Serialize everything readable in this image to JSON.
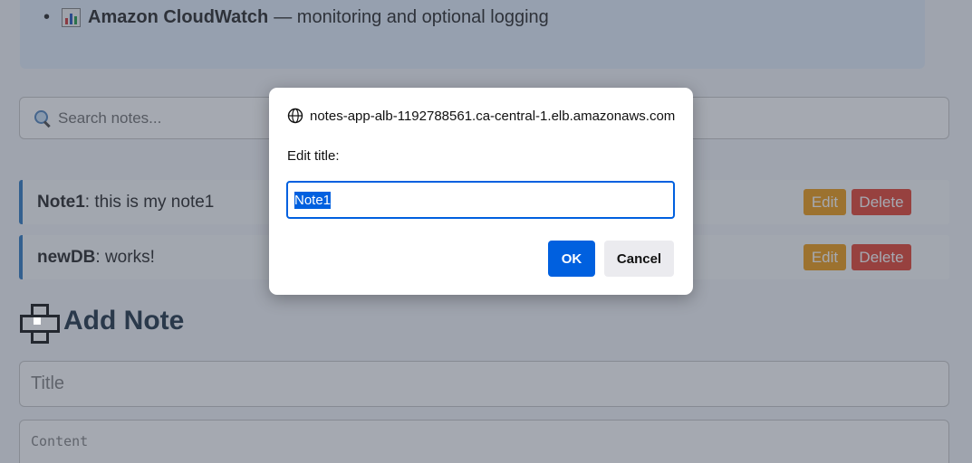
{
  "info": {
    "cloudwatch_name": "Amazon CloudWatch",
    "cloudwatch_desc": "— monitoring and optional logging",
    "icon": "bar-chart-icon"
  },
  "search": {
    "placeholder": "Search notes..."
  },
  "notes": [
    {
      "title": "Note1",
      "content": ": this is my note1",
      "edit_label": "Edit",
      "delete_label": "Delete"
    },
    {
      "title": "newDB",
      "content": ": works!",
      "edit_label": "Edit",
      "delete_label": "Delete"
    }
  ],
  "add_note": {
    "heading": "Add Note",
    "title_placeholder": "Title",
    "content_placeholder": "Content"
  },
  "dialog": {
    "origin": "notes-app-alb-1192788561.ca-central-1.elb.amazonaws.com",
    "message": "Edit title:",
    "input_value": "Note1",
    "ok_label": "OK",
    "cancel_label": "Cancel"
  },
  "colors": {
    "accent": "#3b82c4",
    "edit": "#f0a020",
    "delete": "#e74c3c",
    "dialog_primary": "#0060df"
  }
}
